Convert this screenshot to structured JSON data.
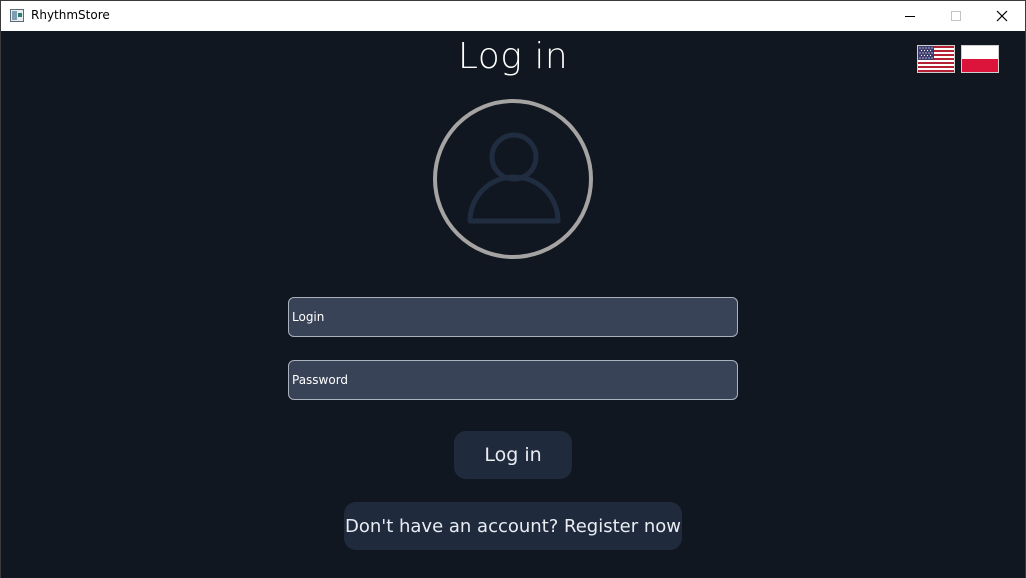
{
  "window": {
    "title": "RhythmStore",
    "icons": {
      "app": "app-window-icon",
      "minimize": "minimize-icon",
      "maximize": "maximize-icon",
      "close": "close-icon"
    }
  },
  "page": {
    "title": "Log in",
    "avatar_icon": "user-avatar-icon"
  },
  "languages": [
    {
      "name": "english-flag-icon"
    },
    {
      "name": "polish-flag-icon"
    }
  ],
  "form": {
    "login_placeholder": "Login",
    "password_placeholder": "Password",
    "login_button": "Log in",
    "register_button": "Don't have an account? Register now"
  },
  "colors": {
    "background": "#111720",
    "field_background": "#384357",
    "button_background": "#1f2a3c",
    "avatar_ring": "#a6a3a3",
    "avatar_figure": "#202c40"
  }
}
